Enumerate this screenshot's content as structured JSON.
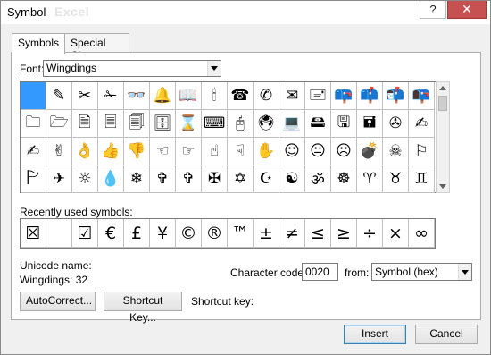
{
  "window": {
    "title": "Symbol",
    "ghost_title": "Excel"
  },
  "titlebar": {
    "help_label": "?",
    "close_label": "✕"
  },
  "tabs": [
    {
      "label": "Symbols",
      "active": true
    },
    {
      "label": "Special Characters",
      "active": false
    }
  ],
  "font": {
    "label": "Font:",
    "value": "Wingdings"
  },
  "symbol_grid": [
    " ",
    "✎",
    "✂",
    "✁",
    "👓",
    "🔔",
    "📖",
    "🕯",
    "☎",
    "✆",
    "✉",
    "🖃",
    "📪",
    "📫",
    "📬",
    "📭",
    "🗀",
    "🗁",
    "🗎",
    "🗏",
    "🗐",
    "🗄",
    "⌛",
    "⌨",
    "🖰",
    "🖲",
    "💻",
    "🖴",
    "🖫",
    "🖬",
    "✇",
    "✍",
    "✍",
    "✌",
    "👌",
    "👍",
    "👎",
    "☜",
    "☞",
    "☝",
    "☟",
    "✋",
    "☺",
    "😐",
    "☹",
    "💣",
    "☠",
    "⚐",
    "🏱",
    "✈",
    "☼",
    "💧",
    "❄",
    "✞",
    "✞",
    "✠",
    "✡",
    "☪",
    "☯",
    "ॐ",
    "☸",
    "♈",
    "♉",
    "♊"
  ],
  "recent": {
    "label": "Recently used symbols:",
    "symbols": [
      "☒",
      "",
      "☑",
      "€",
      "£",
      "¥",
      "©",
      "®",
      "™",
      "±",
      "≠",
      "≤",
      "≥",
      "÷",
      "×",
      "∞"
    ]
  },
  "unicode_name": {
    "label": "Unicode name:",
    "value": "Wingdings: 32"
  },
  "character_code": {
    "label": "Character code:",
    "value": "0020"
  },
  "from": {
    "label": "from:",
    "value": "Symbol (hex)"
  },
  "buttons": {
    "autocorrect": "AutoCorrect...",
    "shortcut_key": "Shortcut Key...",
    "shortcut_key_label": "Shortcut key:",
    "insert": "Insert",
    "cancel": "Cancel"
  }
}
